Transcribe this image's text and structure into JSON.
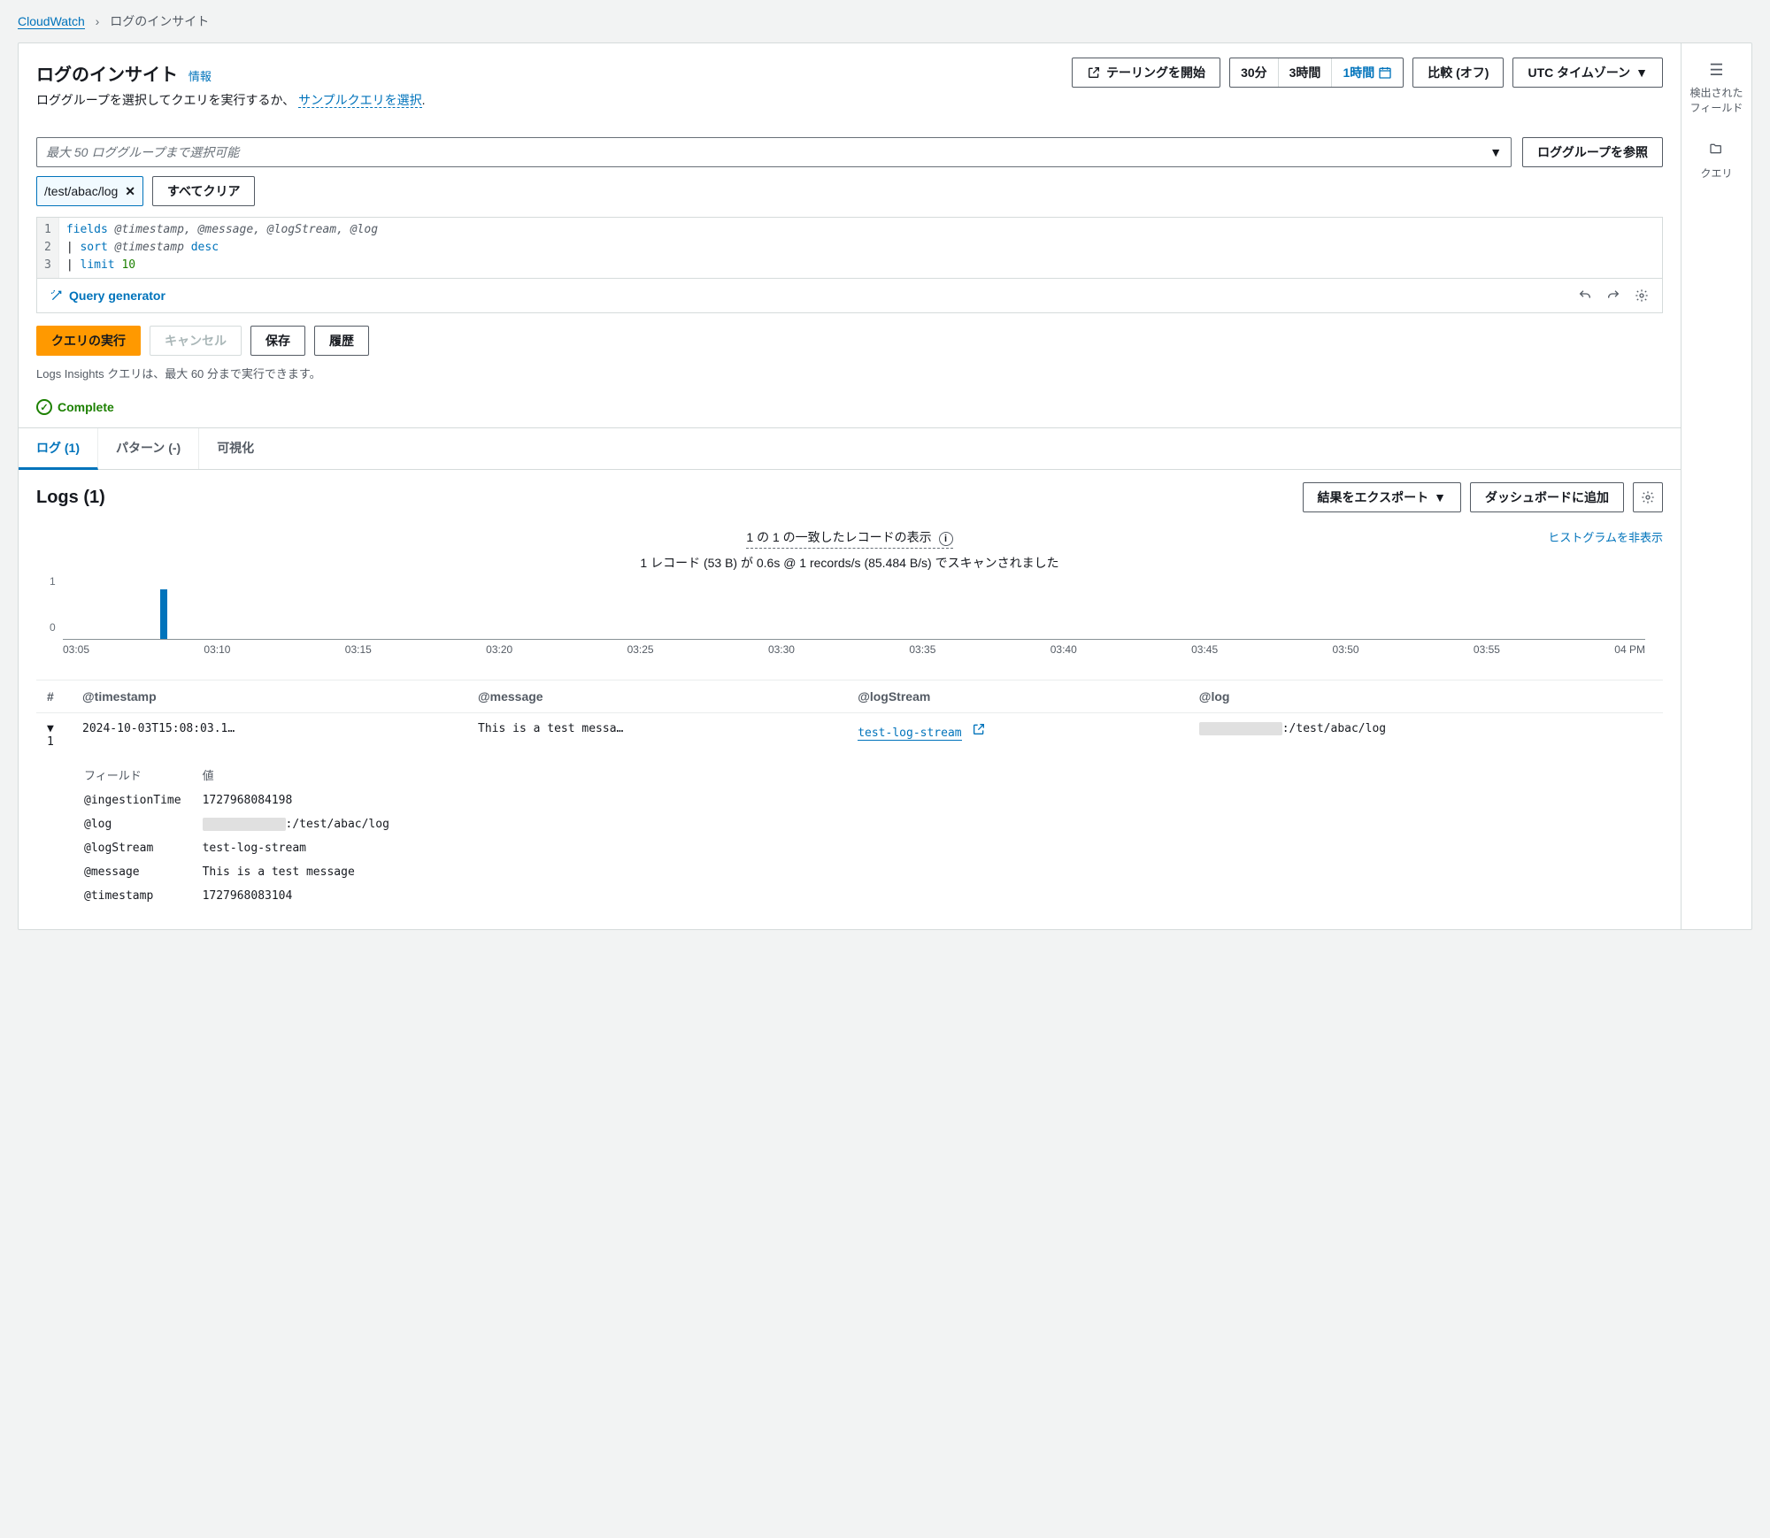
{
  "breadcrumb": {
    "root": "CloudWatch",
    "current": "ログのインサイト"
  },
  "page_title": "ログのインサイト",
  "info_link": "情報",
  "subhead_text": "ロググループを選択してクエリを実行するか、",
  "subhead_link": "サンプルクエリを選択",
  "subhead_suffix": ".",
  "header_buttons": {
    "tailing": "テーリングを開始",
    "range30": "30分",
    "range3h": "3時間",
    "range1h": "1時間",
    "compare": "比較 (オフ)",
    "timezone": "UTC タイムゾーン"
  },
  "log_group_placeholder": "最大 50 ロググループまで選択可能",
  "browse_button": "ロググループを参照",
  "chips": {
    "log_group": "/test/abac/log"
  },
  "clear_all": "すべてクリア",
  "editor": {
    "l1_kw": "fields",
    "l1_vars": " @timestamp, @message, @logStream, @log",
    "l2_pipe": "| ",
    "l2_kw": "sort",
    "l2_var": " @timestamp ",
    "l2_op": "desc",
    "l3_pipe": "| ",
    "l3_kw": "limit",
    "l3_num": " 10"
  },
  "query_generator": "Query generator",
  "run_row": {
    "run": "クエリの実行",
    "cancel": "キャンセル",
    "save": "保存",
    "history": "履歴"
  },
  "note_text": "Logs Insights クエリは、最大 60 分まで実行できます。",
  "status": "Complete",
  "tabs": {
    "logs": "ログ (1)",
    "patterns": "パターン (-)",
    "viz": "可視化"
  },
  "logs_header": {
    "title": "Logs (1)",
    "export": "結果をエクスポート",
    "add_dashboard": "ダッシュボードに追加"
  },
  "records_info": {
    "matched": "1 の 1 の一致したレコードの表示",
    "scanned": "1 レコード (53 B) が 0.6s @ 1 records/s (85.484 B/s) でスキャンされました",
    "hide_histogram": "ヒストグラムを非表示"
  },
  "chart_data": {
    "type": "bar",
    "categories": [
      "03:05",
      "03:10",
      "03:15",
      "03:20",
      "03:25",
      "03:30",
      "03:35",
      "03:40",
      "03:45",
      "03:50",
      "03:55",
      "04 PM"
    ],
    "values": [
      0,
      0,
      0,
      0,
      0,
      0,
      0,
      0,
      0,
      0,
      0,
      0
    ],
    "bar_hits": [
      {
        "index_between": "03:05-03:10",
        "value": 1,
        "pos_percent": 8.5
      }
    ],
    "ylim": [
      0,
      1
    ],
    "ylabel_ticks": [
      "1",
      "0"
    ]
  },
  "columns": {
    "row_num": "#",
    "ts": "@timestamp",
    "msg": "@message",
    "stream": "@logStream",
    "log": "@log"
  },
  "row": {
    "num": "1",
    "ts": "2024-10-03T15:08:03.1…",
    "msg": "This is a test messa…",
    "stream": "test-log-stream",
    "log_redacted": "████████████",
    "log_suffix": ":/test/abac/log"
  },
  "detail_header": {
    "field": "フィールド",
    "value": "値"
  },
  "details": [
    {
      "field": "@ingestionTime",
      "value": "1727968084198"
    },
    {
      "field": "@log",
      "redacted": "████████████",
      "suffix": ":/test/abac/log"
    },
    {
      "field": "@logStream",
      "value": "test-log-stream"
    },
    {
      "field": "@message",
      "value": "This is a test message"
    },
    {
      "field": "@timestamp",
      "value": "1727968083104"
    }
  ],
  "side_rail": {
    "fields": "検出されたフィールド",
    "queries": "クエリ"
  }
}
